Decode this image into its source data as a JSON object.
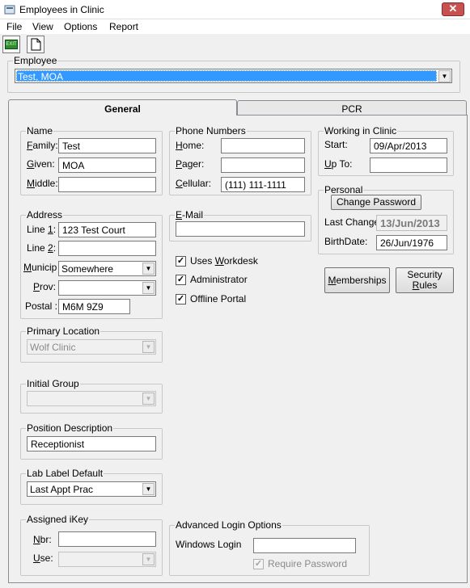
{
  "window": {
    "title": "Employees in Clinic",
    "close": "✕"
  },
  "menu": [
    "File",
    "View",
    "Options",
    "Report"
  ],
  "toolbar": {
    "exit_label": "EXIT"
  },
  "employee": {
    "legend": "Employee",
    "selected": "Test, MOA"
  },
  "tabs": {
    "general": "General",
    "pcr": "PCR"
  },
  "name": {
    "legend": "Name",
    "family_label": "Family:",
    "family": "Test",
    "given_label": "Given:",
    "given": "MOA",
    "middle_label": "Middle:",
    "middle": ""
  },
  "phone": {
    "legend": "Phone Numbers",
    "home_label": "Home:",
    "home": "",
    "pager_label": "Pager:",
    "pager": "",
    "cellular_label": "Cellular:",
    "cellular": "(111) 111-1111"
  },
  "working": {
    "legend": "Working in Clinic",
    "start_label": "Start:",
    "start": "09/Apr/2013",
    "upto_label": "Up To:",
    "upto": ""
  },
  "personal": {
    "legend": "Personal",
    "change_password": "Change Password",
    "last_change_label": "Last Change",
    "last_change": "13/Jun/2013",
    "birthdate_label": "BirthDate:",
    "birthdate": "26/Jun/1976"
  },
  "address": {
    "legend": "Address",
    "line1_label": "Line 1:",
    "line1": "123 Test Court",
    "line2_label": "Line 2:",
    "line2": "",
    "municip_label": "Municip",
    "municip": "Somewhere",
    "prov_label": "Prov:",
    "prov": "",
    "postal_label": "Postal :",
    "postal": "M6M 9Z9"
  },
  "email": {
    "legend": "E-Mail",
    "value": ""
  },
  "checks": {
    "uses_workdesk": "Uses Workdesk",
    "administrator": "Administrator",
    "offline_portal": "Offline Portal"
  },
  "buttons": {
    "memberships": "Memberships",
    "security_rules_1": "Security",
    "security_rules_2": "Rules"
  },
  "primary_location": {
    "legend": "Primary Location",
    "value": "Wolf Clinic"
  },
  "initial_group": {
    "legend": "Initial Group",
    "value": ""
  },
  "position_description": {
    "legend": "Position Description",
    "value": "Receptionist"
  },
  "lab_label": {
    "legend": "Lab Label Default",
    "value": "Last Appt Prac"
  },
  "ikey": {
    "legend": "Assigned iKey",
    "nbr_label": "Nbr:",
    "nbr": "",
    "use_label": "Use:",
    "use": ""
  },
  "advanced_login": {
    "legend": "Advanced Login Options",
    "windows_login_label": "Windows Login",
    "windows_login": "",
    "require_password": "Require Password"
  }
}
